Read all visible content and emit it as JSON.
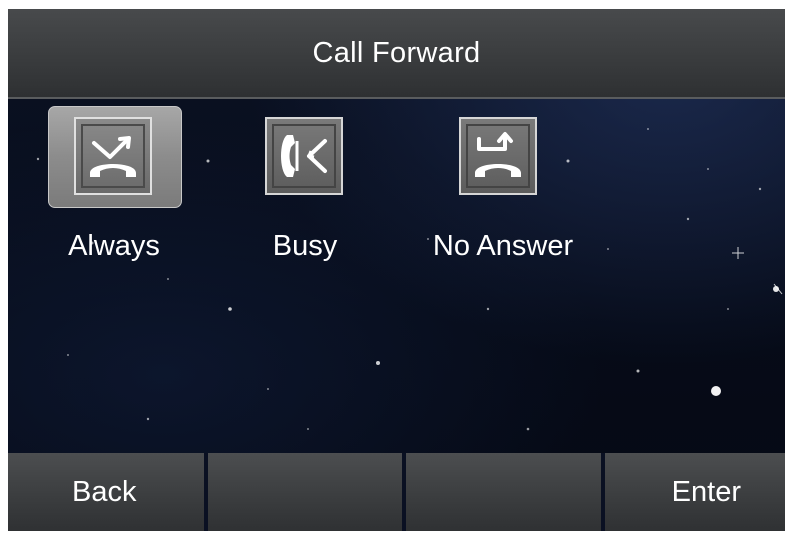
{
  "header": {
    "title": "Call Forward"
  },
  "menu": {
    "items": [
      {
        "label": "Always",
        "icon": "phone-forward-out-icon",
        "selected": true
      },
      {
        "label": "Busy",
        "icon": "phone-busy-forward-icon",
        "selected": false
      },
      {
        "label": "No Answer",
        "icon": "phone-no-answer-forward-icon",
        "selected": false
      }
    ]
  },
  "softkeys": {
    "key1": "Back",
    "key2": "",
    "key3": "",
    "key4": "Enter"
  },
  "colors": {
    "title_bar": "#3f4143",
    "softkey_bar": "#3d3f41",
    "selected_tile": "#8f8f8f",
    "icon_tile": "#6a6a6a",
    "background": "#070c1a",
    "text": "#ffffff"
  }
}
